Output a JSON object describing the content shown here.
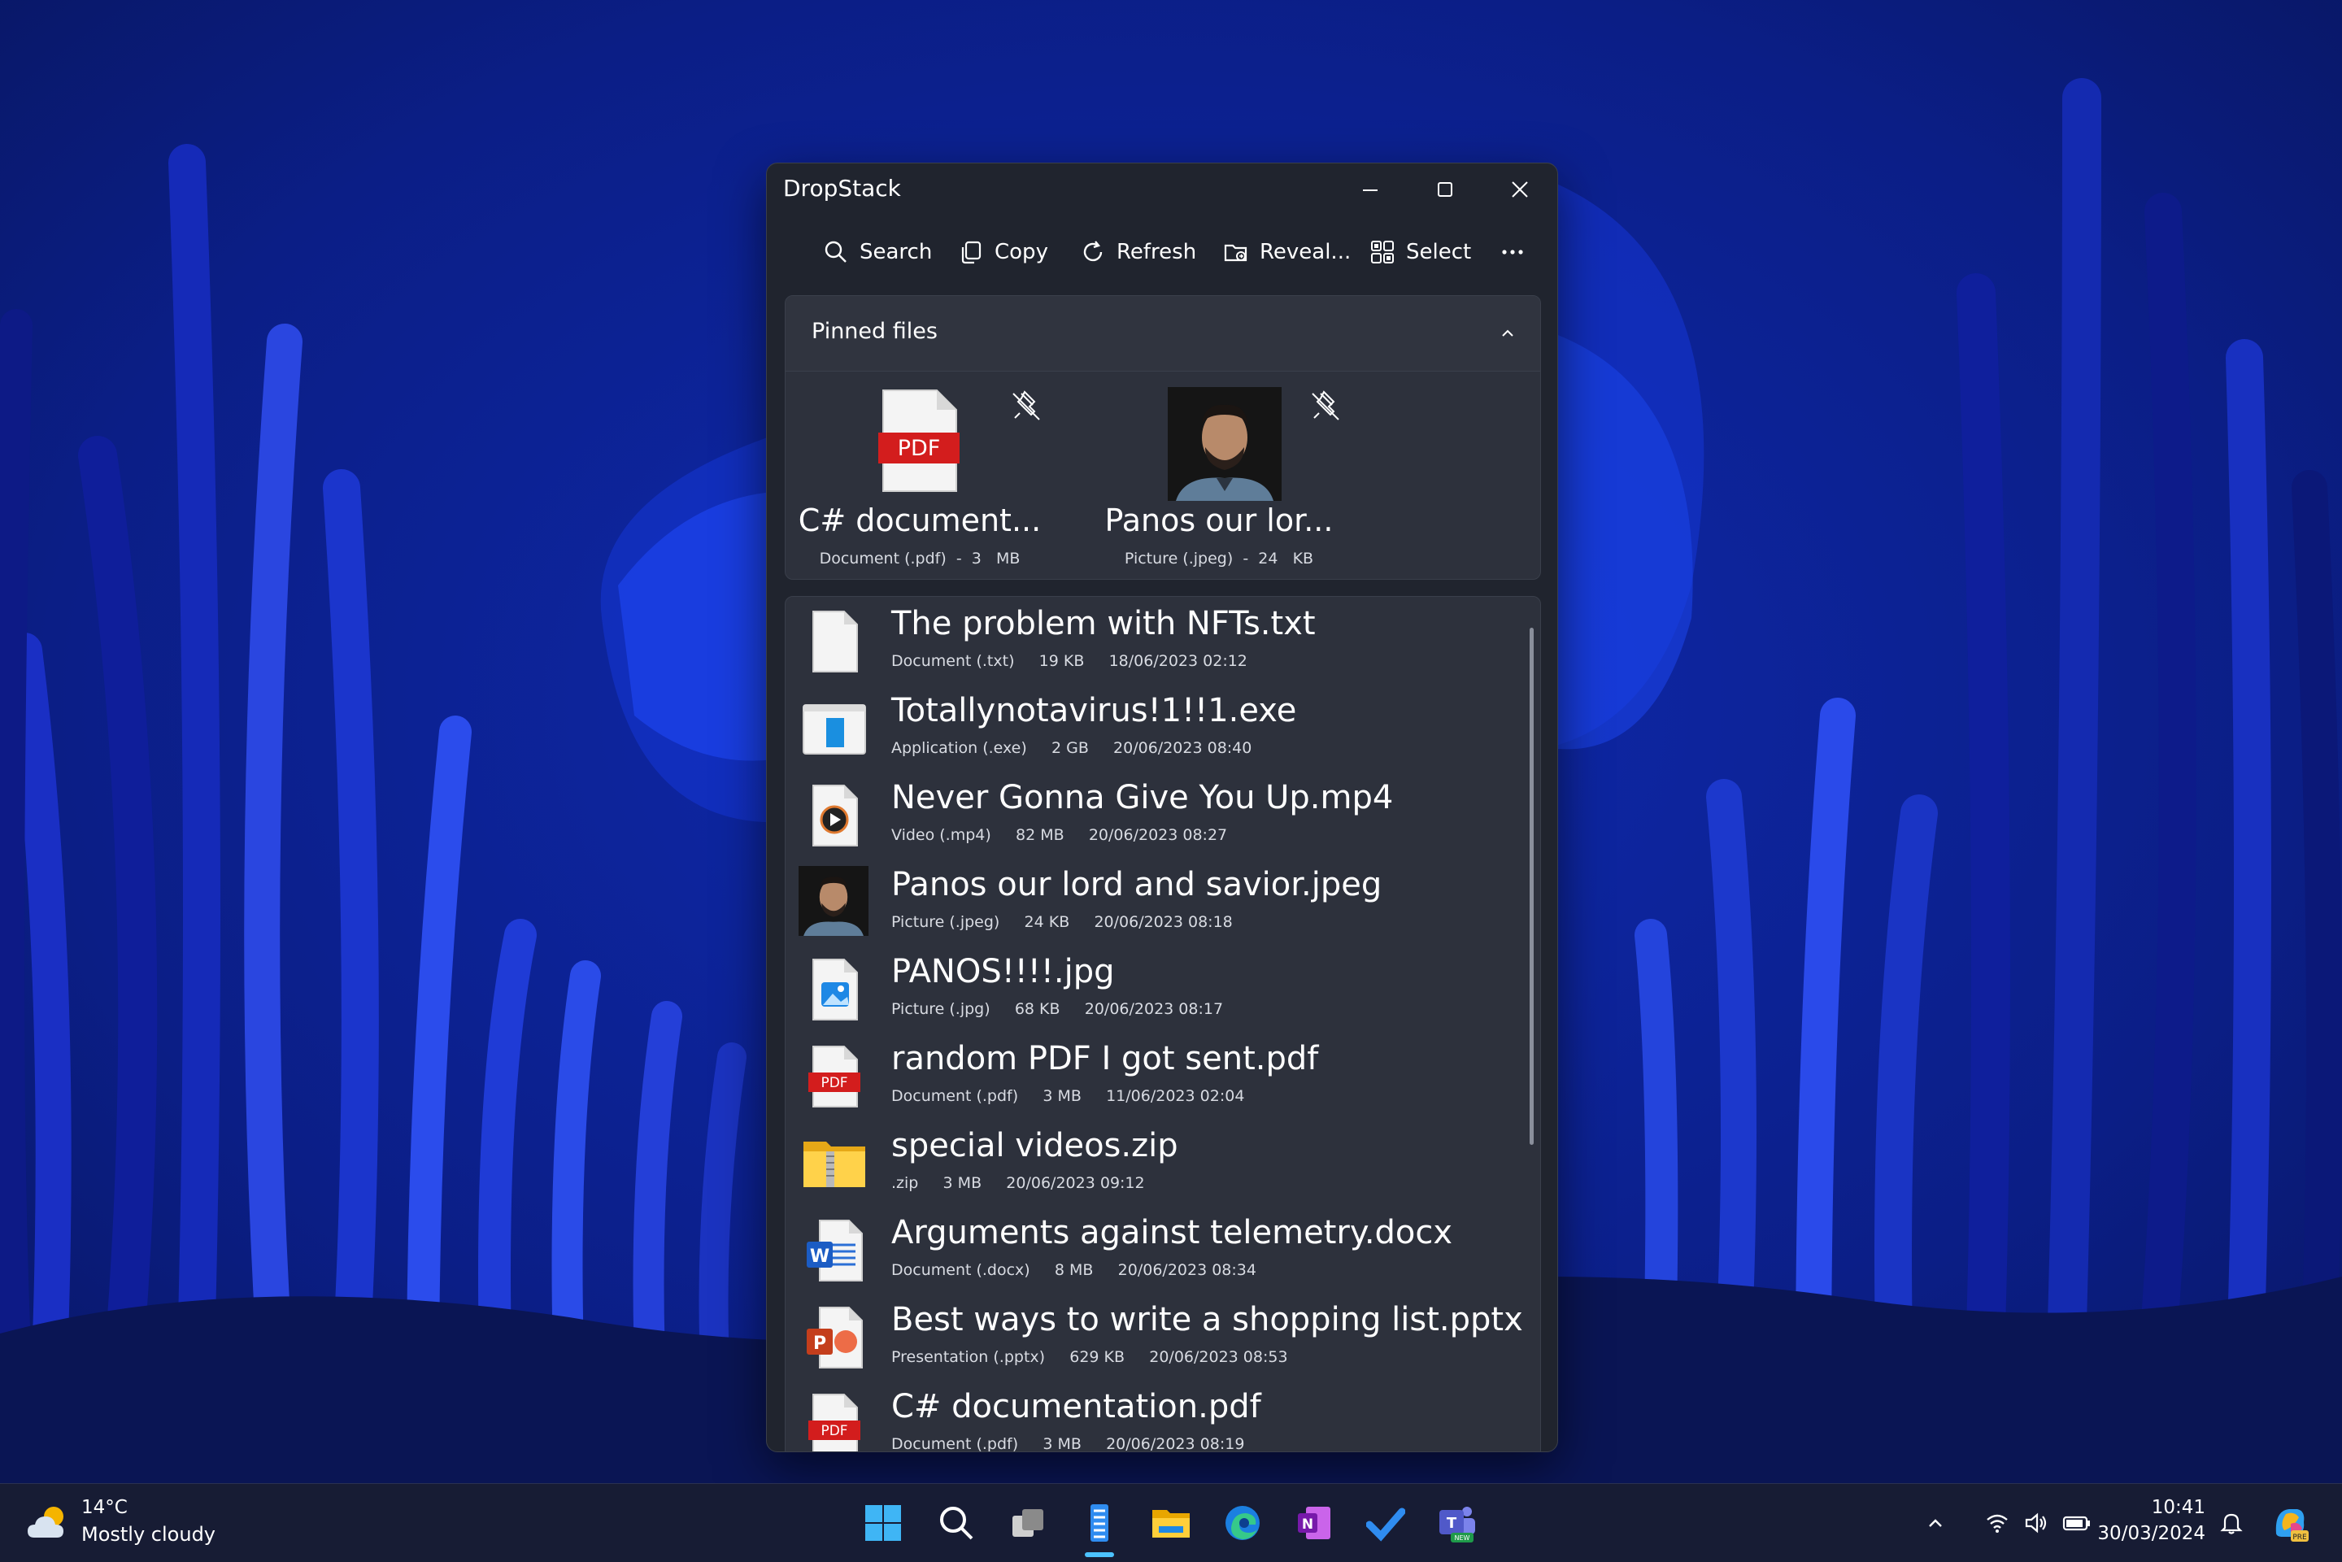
{
  "window": {
    "title": "DropStack",
    "controls": {
      "minimize": "minimize-icon",
      "maximize": "maximize-icon",
      "close": "close-icon"
    }
  },
  "toolbar": {
    "search": "Search",
    "copy": "Copy",
    "refresh": "Refresh",
    "reveal": "Reveal...",
    "select": "Select",
    "more": "more-icon"
  },
  "pinned": {
    "title": "Pinned files",
    "items": [
      {
        "name": "C# document...",
        "meta": "Document (.pdf)  -  3   MB",
        "icon": "pdf-icon"
      },
      {
        "name": "Panos our lor...",
        "meta": "Picture (.jpeg)  -  24   KB",
        "icon": "photo-thumbnail"
      }
    ]
  },
  "files": [
    {
      "name": "The problem with NFTs.txt",
      "meta": "Document (.txt)     19 KB     18/06/2023 02:12",
      "icon": "text-file-icon"
    },
    {
      "name": "Totallynotavirus!1!!1.exe",
      "meta": "Application (.exe)     2 GB     20/06/2023 08:40",
      "icon": "exe-file-icon"
    },
    {
      "name": "Never Gonna Give You Up.mp4",
      "meta": "Video (.mp4)     82 MB     20/06/2023 08:27",
      "icon": "video-file-icon"
    },
    {
      "name": "Panos our lord and savior.jpeg",
      "meta": "Picture (.jpeg)     24 KB     20/06/2023 08:18",
      "icon": "photo-thumbnail"
    },
    {
      "name": "PANOS!!!!.jpg",
      "meta": "Picture (.jpg)     68 KB     20/06/2023 08:17",
      "icon": "image-file-icon"
    },
    {
      "name": "random PDF I got sent.pdf",
      "meta": "Document (.pdf)     3 MB     11/06/2023 02:04",
      "icon": "pdf-icon"
    },
    {
      "name": "special videos.zip",
      "meta": ".zip     3 MB     20/06/2023 09:12",
      "icon": "zip-folder-icon"
    },
    {
      "name": "Arguments against telemetry.docx",
      "meta": "Document (.docx)     8 MB     20/06/2023 08:34",
      "icon": "word-file-icon"
    },
    {
      "name": "Best ways to write a shopping list.pptx",
      "meta": "Presentation (.pptx)     629 KB     20/06/2023 08:53",
      "icon": "powerpoint-file-icon"
    },
    {
      "name": "C# documentation.pdf",
      "meta": "Document (.pdf)     3 MB     20/06/2023 08:19",
      "icon": "pdf-icon"
    }
  ],
  "taskbar": {
    "weather": {
      "temp": "14°C",
      "desc": "Mostly cloudy"
    },
    "clock": {
      "time": "10:41",
      "date": "30/03/2024"
    },
    "apps": [
      "windows-start-icon",
      "search-icon",
      "task-view-icon",
      "dropstack-app-icon",
      "file-explorer-icon",
      "edge-icon",
      "onenote-icon",
      "todo-icon",
      "teams-icon"
    ],
    "tray": [
      "chevron-up-icon",
      "wifi-icon",
      "volume-icon",
      "battery-icon",
      "bell-icon",
      "copilot-icon"
    ]
  },
  "colors": {
    "window_bg": "#20242e",
    "panel_bg": "#2d313c",
    "accent": "#4cc2ff",
    "pdf_red": "#d31d1d",
    "wallpaper_blue": "#0a1a6e"
  }
}
